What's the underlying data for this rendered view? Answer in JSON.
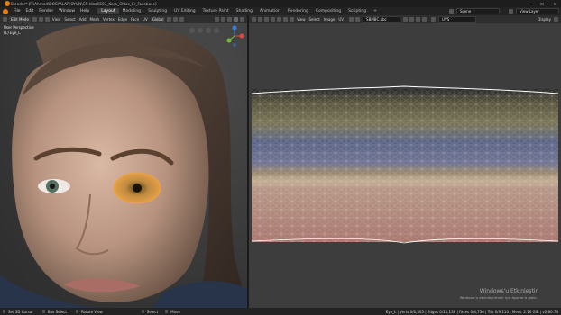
{
  "window": {
    "title": "Blender* [F:\\Ahmed\\DOSYALAR\\OYUN\\CR Ideal\\E03_Kara_Chloe_Er_Facebase]",
    "minimize": "—",
    "maximize": "☐",
    "close": "✕"
  },
  "menu": [
    "File",
    "Edit",
    "Render",
    "Window",
    "Help"
  ],
  "workspaces": [
    "Layout",
    "Modeling",
    "Sculpting",
    "UV Editing",
    "Texture Paint",
    "Shading",
    "Animation",
    "Rendering",
    "Compositing",
    "Scripting"
  ],
  "active_workspace": "Layout",
  "scene": {
    "label": "Scene",
    "view_layer": "View Layer"
  },
  "viewport_header": {
    "mode": "Edit Mode",
    "menus": [
      "View",
      "Select",
      "Add",
      "Mesh",
      "Vertex",
      "Edge",
      "Face",
      "UV"
    ],
    "orientation": "Global"
  },
  "uv_header": {
    "menus": [
      "View",
      "Select",
      "Image",
      "UV"
    ],
    "image_name": "SBMBC.abc",
    "uv_map": "UVS",
    "display": "Display"
  },
  "viewport": {
    "perspective": "User Perspective",
    "object": "(1) Eye_L"
  },
  "watermark": {
    "line1": "Windows'u Etkinleştir",
    "line2": "Windows'u etkinleştirmek için Ayarlar'a gidin."
  },
  "statusbar": {
    "left": [
      "Set 3D Cursor",
      "Box Select",
      "Rotate View"
    ],
    "middle": [
      "Select",
      "Move"
    ],
    "right": "Eye_L | Verts 0/6,503 | Edges 0/11,138 | Faces 0/4,736 | Tris 0/9,110 | Mem: 2.16 GiB | v2.80.74"
  },
  "colors": {
    "accent": "#e87d0d",
    "axis_x": "#e0473d",
    "axis_y": "#79b93a",
    "axis_z": "#3d7de0"
  }
}
